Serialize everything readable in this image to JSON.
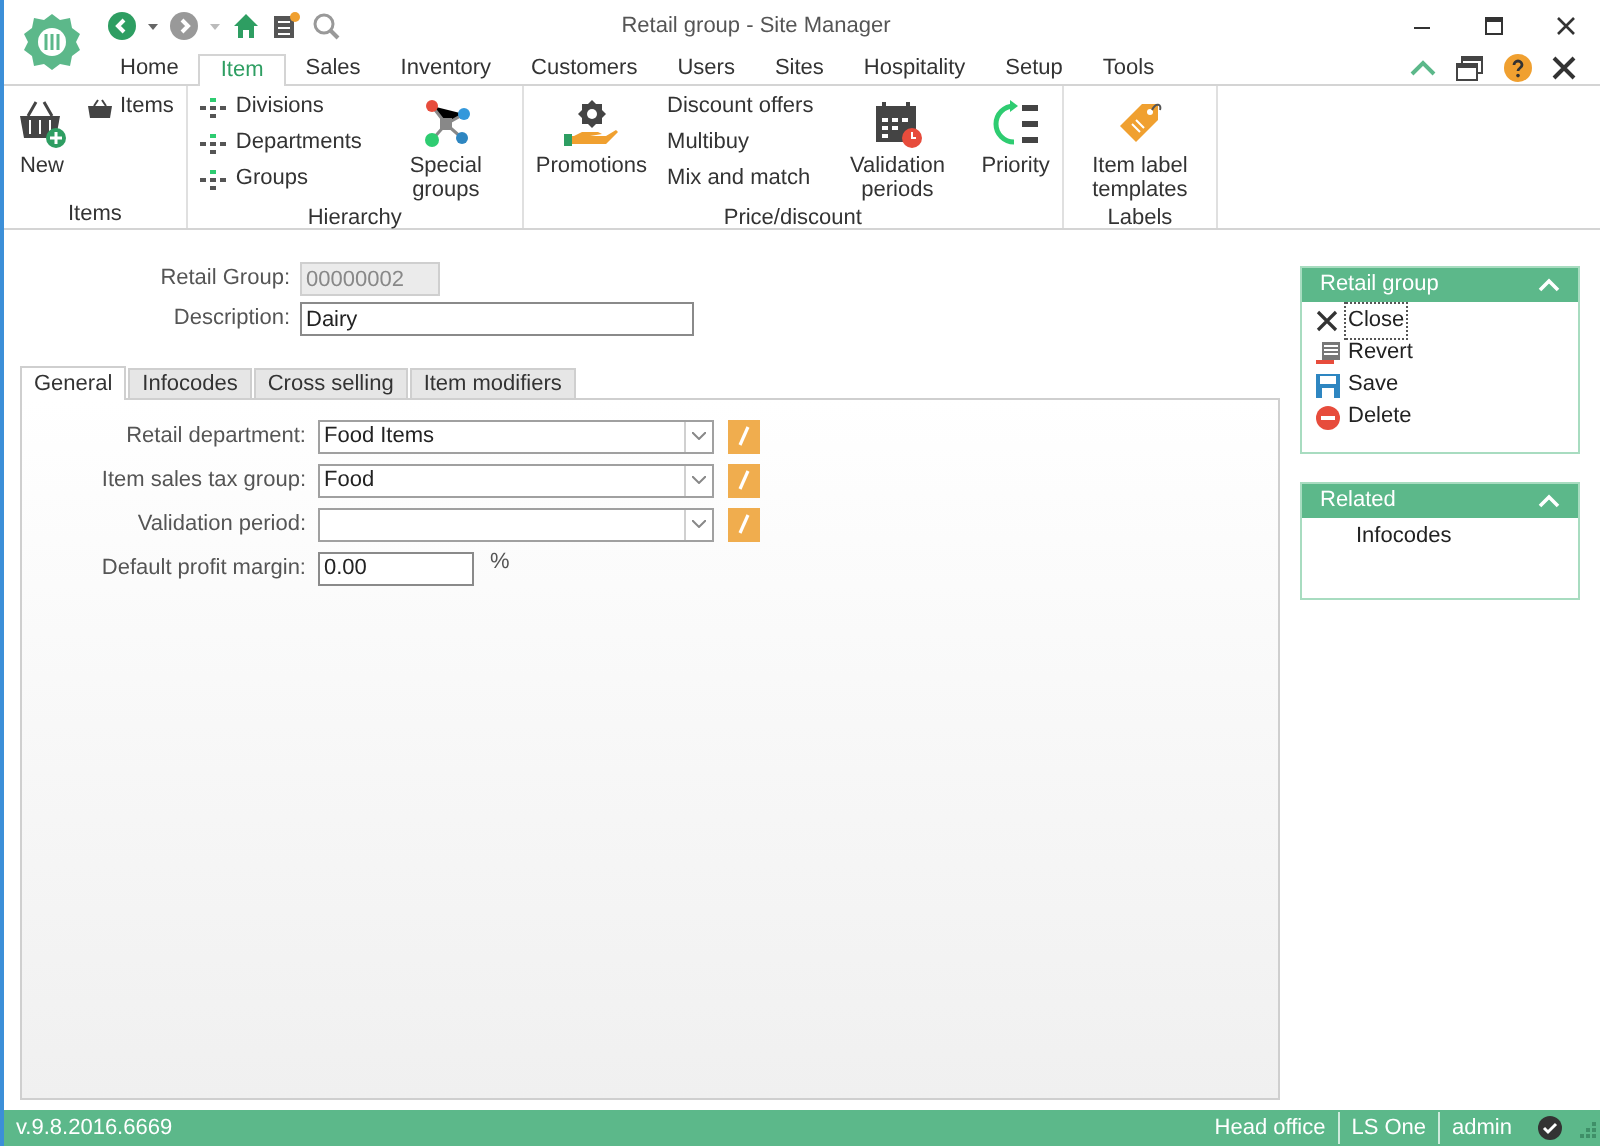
{
  "window": {
    "title": "Retail group - Site Manager"
  },
  "menu_tabs": [
    {
      "label": "Home",
      "selected": false
    },
    {
      "label": "Item",
      "selected": true
    },
    {
      "label": "Sales",
      "selected": false
    },
    {
      "label": "Inventory",
      "selected": false
    },
    {
      "label": "Customers",
      "selected": false
    },
    {
      "label": "Users",
      "selected": false
    },
    {
      "label": "Sites",
      "selected": false
    },
    {
      "label": "Hospitality",
      "selected": false
    },
    {
      "label": "Setup",
      "selected": false
    },
    {
      "label": "Tools",
      "selected": false
    }
  ],
  "ribbon": {
    "groups": [
      {
        "label": "Items",
        "items": [
          {
            "label": "New",
            "kind": "large"
          },
          {
            "label": "Items",
            "kind": "small"
          }
        ]
      },
      {
        "label": "Hierarchy",
        "items": [
          {
            "label": "Divisions",
            "kind": "small"
          },
          {
            "label": "Departments",
            "kind": "small"
          },
          {
            "label": "Groups",
            "kind": "small"
          },
          {
            "label": "Special groups",
            "kind": "large"
          }
        ]
      },
      {
        "label": "Price/discount",
        "items": [
          {
            "label": "Promotions",
            "kind": "large"
          },
          {
            "label": "Discount offers",
            "kind": "small"
          },
          {
            "label": "Multibuy",
            "kind": "small"
          },
          {
            "label": "Mix and match",
            "kind": "small"
          },
          {
            "label": "Validation periods",
            "kind": "large"
          },
          {
            "label": "Priority",
            "kind": "large"
          }
        ]
      },
      {
        "label": "Labels",
        "items": [
          {
            "label": "Item label templates",
            "kind": "large"
          }
        ]
      }
    ]
  },
  "header_fields": [
    {
      "label": "Retail Group:",
      "value": "00000002",
      "disabled": true
    },
    {
      "label": "Description:",
      "value": "Dairy",
      "disabled": false
    }
  ],
  "detail_tabs": [
    {
      "label": "General",
      "selected": true
    },
    {
      "label": "Infocodes",
      "selected": false
    },
    {
      "label": "Cross selling",
      "selected": false
    },
    {
      "label": "Item modifiers",
      "selected": false
    }
  ],
  "general_fields": [
    {
      "kind": "combo",
      "label": "Retail department:",
      "value": "Food Items"
    },
    {
      "kind": "combo",
      "label": "Item sales tax group:",
      "value": "Food"
    },
    {
      "kind": "combo",
      "label": "Validation period:"
    },
    {
      "kind": "number",
      "label": "Default profit margin:",
      "value": "0.00",
      "suffix": "%"
    }
  ],
  "panels": [
    {
      "title": "Retail group",
      "expanded": true,
      "actions": [
        {
          "label": "Close",
          "kind": "close",
          "focused": true
        },
        {
          "label": "Revert",
          "kind": "revert",
          "focused": false
        },
        {
          "label": "Save",
          "kind": "save",
          "focused": false
        },
        {
          "label": "Delete",
          "kind": "delete",
          "focused": false
        }
      ]
    },
    {
      "title": "Related",
      "expanded": true,
      "actions": [
        {
          "label": "Infocodes",
          "kind": "link",
          "focused": false
        }
      ]
    }
  ],
  "status_bar": {
    "version": "v.9.8.2016.6669",
    "segments": [
      "Head office",
      "LS One",
      "admin"
    ]
  }
}
